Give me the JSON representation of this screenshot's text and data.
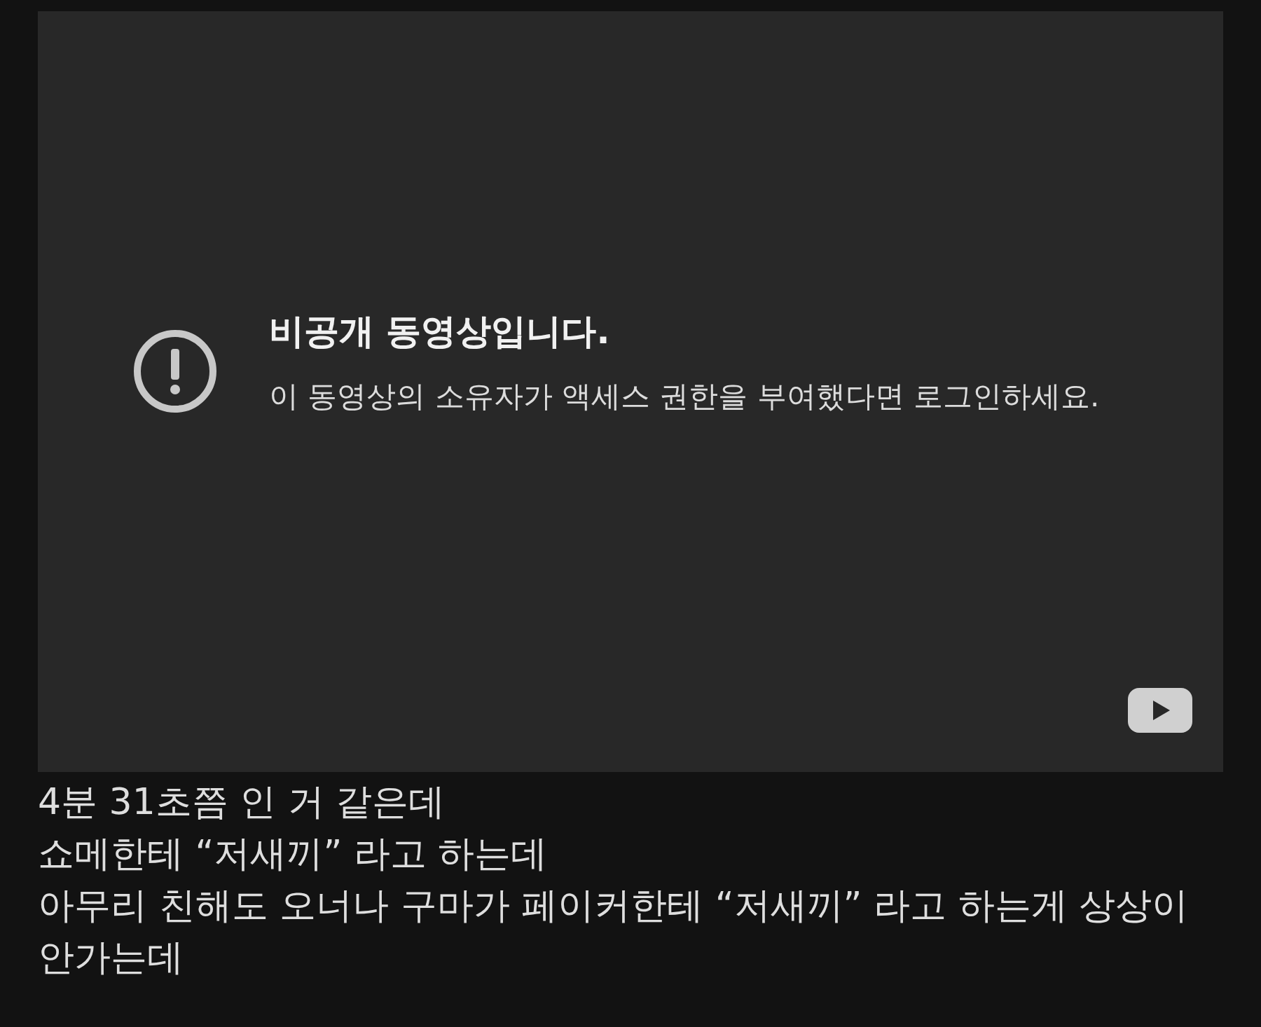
{
  "video": {
    "error_title": "비공개 동영상입니다.",
    "error_message": "이 동영상의 소유자가 액세스 권한을 부여했다면 로그인하세요."
  },
  "comment_lines": [
    "4분 31초쯤 인 거 같은데",
    "쇼메한테 “저새끼” 라고 하는데",
    "아무리 친해도 오너나 구마가 페이커한테 “저새끼” 라고 하는게 상상이",
    "안가는데"
  ]
}
